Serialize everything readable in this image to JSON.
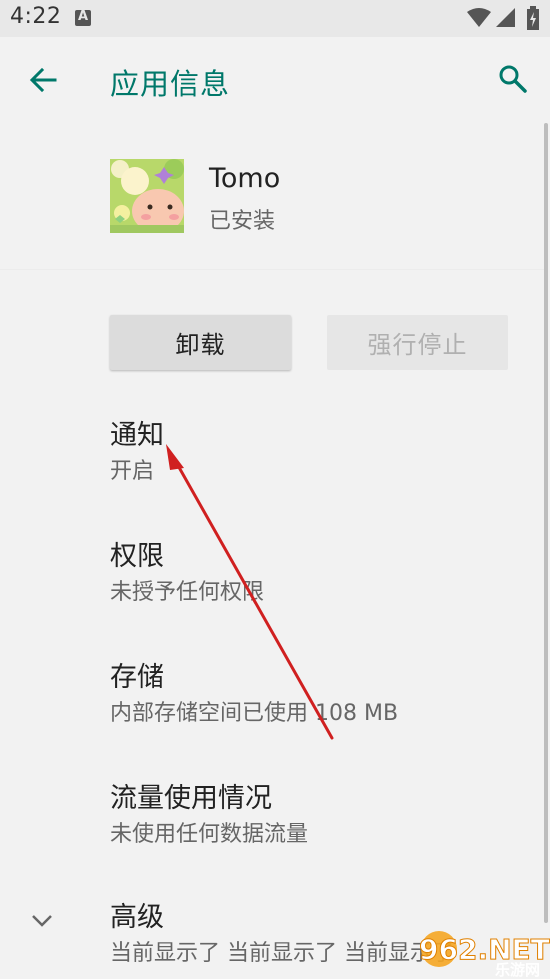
{
  "status_bar": {
    "time": "4:22"
  },
  "toolbar": {
    "title": "应用信息",
    "back_icon": "arrow-left",
    "search_icon": "magnifier"
  },
  "app": {
    "name": "Tomo",
    "status": "已安装"
  },
  "buttons": {
    "uninstall": "卸载",
    "force_stop": "强行停止"
  },
  "items": [
    {
      "title": "通知",
      "subtitle": "开启"
    },
    {
      "title": "权限",
      "subtitle": "未授予任何权限"
    },
    {
      "title": "存储",
      "subtitle": "内部存储空间已使用 108 MB"
    },
    {
      "title": "流量使用情况",
      "subtitle": "未使用任何数据流量"
    },
    {
      "title": "高级",
      "subtitle": "当前显示了 当前显示了 当前显示了"
    }
  ],
  "watermark": {
    "text": "962.NET",
    "subtext": "乐游网"
  },
  "colors": {
    "accent": "#00786a",
    "annotation": "#d02020"
  }
}
